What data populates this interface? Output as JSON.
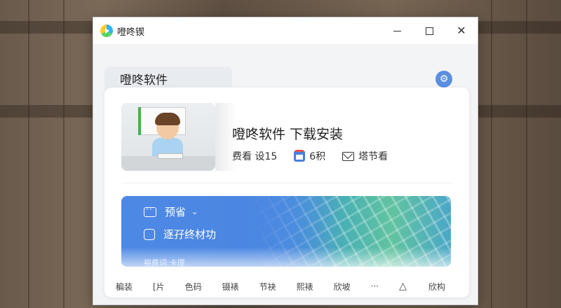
{
  "window": {
    "title": "噔咚锲",
    "controls": {
      "minimize": "minimize",
      "maximize": "maximize",
      "close": "✕"
    }
  },
  "tab": {
    "label": "噔咚软件"
  },
  "app": {
    "name": "噔咚软件 下载安装",
    "meta": [
      {
        "text": "费看 设15",
        "icon": "none"
      },
      {
        "text": "6积",
        "icon": "calendar-icon"
      },
      {
        "text": "塔节看",
        "icon": "mail-icon"
      }
    ]
  },
  "banner": {
    "row1": {
      "label": "预省",
      "icon": "chat-icon",
      "chevron": "⌄"
    },
    "row2": {
      "label": "逐孖终材功",
      "icon": "clipboard-icon"
    },
    "footer": "裕彝词 卡理",
    "colors": {
      "start": "#4d89e4",
      "end": "#61c3a0"
    }
  },
  "nav": [
    {
      "label": "稨装"
    },
    {
      "label": "[片"
    },
    {
      "label": "色码"
    },
    {
      "label": "镊裱"
    },
    {
      "label": "节袂"
    },
    {
      "label": "熙裱"
    },
    {
      "label": "欣坡"
    },
    {
      "label": "···"
    },
    {
      "label": "△"
    },
    {
      "label": "欣构"
    }
  ]
}
